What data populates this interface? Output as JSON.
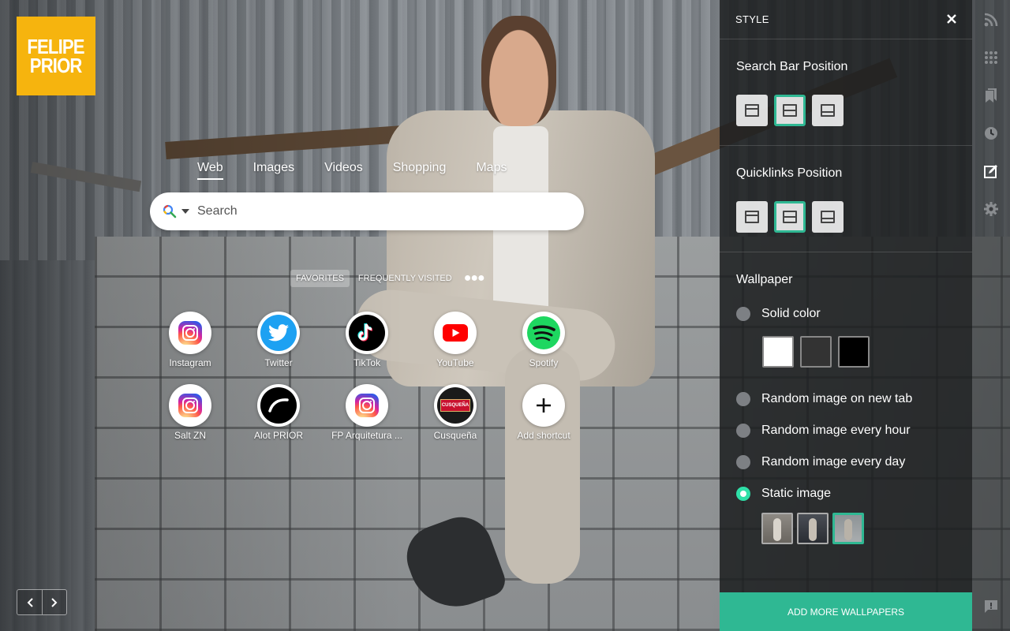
{
  "logo": {
    "line1": "FELIPE",
    "line2": "PRIOR",
    "color": "#f6b40e"
  },
  "search": {
    "tabs": [
      {
        "label": "Web",
        "active": true
      },
      {
        "label": "Images",
        "active": false
      },
      {
        "label": "Videos",
        "active": false
      },
      {
        "label": "Shopping",
        "active": false
      },
      {
        "label": "Maps",
        "active": false
      }
    ],
    "placeholder": "Search",
    "engine_icon": "magnifier-multicolor-icon"
  },
  "quicklinks": {
    "tabs": [
      {
        "label": "FAVORITES",
        "active": true
      },
      {
        "label": "FREQUENTLY VISITED",
        "active": false
      }
    ],
    "more_icon": "more-dots-icon",
    "items": [
      {
        "label": "Instagram",
        "icon": "instagram-icon"
      },
      {
        "label": "Twitter",
        "icon": "twitter-icon"
      },
      {
        "label": "TikTok",
        "icon": "tiktok-icon"
      },
      {
        "label": "YouTube",
        "icon": "youtube-icon"
      },
      {
        "label": "Spotify",
        "icon": "spotify-icon"
      },
      {
        "label": "Salt ZN",
        "icon": "instagram-icon"
      },
      {
        "label": "Alot PRIOR",
        "icon": "alot-prior-icon"
      },
      {
        "label": "FP Arquitetura ...",
        "icon": "instagram-icon"
      },
      {
        "label": "Cusqueña",
        "icon": "cusquena-icon"
      },
      {
        "label": "Add shortcut",
        "icon": "plus-icon"
      }
    ]
  },
  "panel": {
    "title": "STYLE",
    "search_bar_position": {
      "title": "Search Bar Position",
      "selected": "middle"
    },
    "quicklinks_position": {
      "title": "Quicklinks Position",
      "selected": "middle"
    },
    "wallpaper": {
      "title": "Wallpaper",
      "options": [
        {
          "label": "Solid color",
          "checked": false
        },
        {
          "label": "Random image on new tab",
          "checked": false
        },
        {
          "label": "Random image every hour",
          "checked": false
        },
        {
          "label": "Random image every day",
          "checked": false
        },
        {
          "label": "Static image",
          "checked": true
        }
      ],
      "solid_colors": [
        "#ffffff",
        "#333333",
        "#000000"
      ],
      "selected_thumbnail": 3
    },
    "add_button": "ADD MORE WALLPAPERS",
    "accent": "#2fb893"
  },
  "rail": [
    "rss-icon",
    "apps-grid-icon",
    "bookmarks-icon",
    "history-icon",
    "style-edit-icon",
    "settings-icon",
    "feedback-icon"
  ]
}
